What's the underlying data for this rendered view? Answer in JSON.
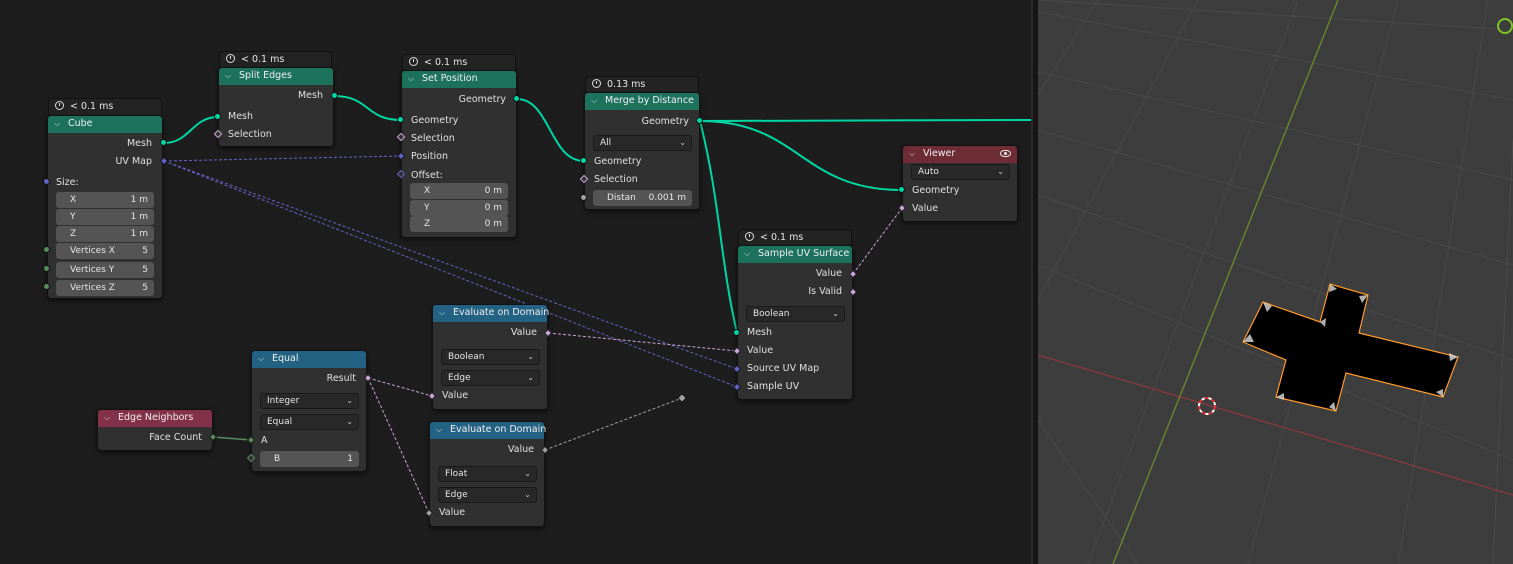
{
  "nodes": {
    "cube": {
      "timing": "< 0.1 ms",
      "title": "Cube",
      "out_mesh": "Mesh",
      "out_uvmap": "UV Map",
      "size_label": "Size:",
      "x_label": "X",
      "x_value": "1 m",
      "y_label": "Y",
      "y_value": "1 m",
      "z_label": "Z",
      "z_value": "1 m",
      "vx_label": "Vertices X",
      "vx_value": "5",
      "vy_label": "Vertices Y",
      "vy_value": "5",
      "vz_label": "Vertices Z",
      "vz_value": "5"
    },
    "split_edges": {
      "timing": "< 0.1 ms",
      "title": "Split Edges",
      "out_mesh": "Mesh",
      "in_mesh": "Mesh",
      "in_selection": "Selection"
    },
    "set_position": {
      "timing": "< 0.1 ms",
      "title": "Set Position",
      "out_geometry": "Geometry",
      "in_geometry": "Geometry",
      "in_selection": "Selection",
      "in_position": "Position",
      "in_offset": "Offset:",
      "x_label": "X",
      "x_value": "0 m",
      "y_label": "Y",
      "y_value": "0 m",
      "z_label": "Z",
      "z_value": "0 m"
    },
    "merge": {
      "timing": "0.13 ms",
      "title": "Merge by Distance",
      "out_geometry": "Geometry",
      "mode": "All",
      "in_geometry": "Geometry",
      "in_selection": "Selection",
      "distance_label": "Distan",
      "distance_value": "0.001 m"
    },
    "viewer": {
      "title": "Viewer",
      "domain": "Auto",
      "in_geometry": "Geometry",
      "in_value": "Value"
    },
    "sample_uv": {
      "timing": "< 0.1 ms",
      "title": "Sample UV Surface",
      "out_value": "Value",
      "out_valid": "Is Valid",
      "type": "Boolean",
      "in_mesh": "Mesh",
      "in_value": "Value",
      "in_source_uv": "Source UV Map",
      "in_sample_uv": "Sample UV"
    },
    "eval1": {
      "title": "Evaluate on Domain",
      "out_value": "Value",
      "type": "Boolean",
      "domain": "Edge",
      "in_value": "Value"
    },
    "eval2": {
      "title": "Evaluate on Domain",
      "out_value": "Value",
      "type": "Float",
      "domain": "Edge",
      "in_value": "Value"
    },
    "equal": {
      "title": "Equal",
      "out_result": "Result",
      "type": "Integer",
      "operation": "Equal",
      "in_a": "A",
      "b_label": "B",
      "b_value": "1"
    },
    "edge_neighbors": {
      "title": "Edge Neighbors",
      "out_face_count": "Face Count"
    }
  },
  "colors": {
    "geometry_header": "#1d725e",
    "attribute_header": "#3b6788",
    "input_header": "#83314a",
    "viewer_header": "#6e2c35",
    "geometry_link": "#00d6a3"
  }
}
